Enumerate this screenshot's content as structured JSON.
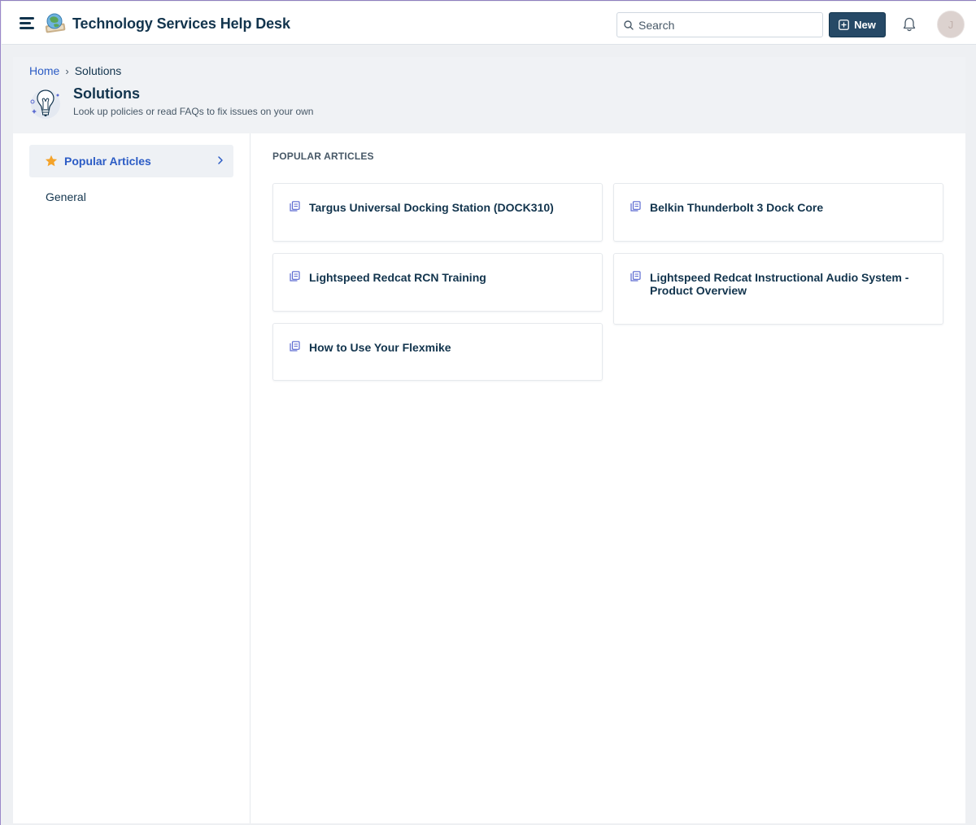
{
  "header": {
    "app_title": "Technology Services Help Desk",
    "search_placeholder": "Search",
    "new_button_label": "New",
    "avatar_initial": "J"
  },
  "breadcrumb": {
    "home": "Home",
    "current": "Solutions"
  },
  "page": {
    "title": "Solutions",
    "subtitle": "Look up policies or read FAQs to fix issues on your own"
  },
  "sidebar": {
    "items": [
      {
        "label": "Popular Articles",
        "active": true
      },
      {
        "label": "General",
        "active": false
      }
    ]
  },
  "main": {
    "section_title": "POPULAR ARTICLES",
    "articles": [
      {
        "title": "Targus Universal Docking Station (DOCK310)"
      },
      {
        "title": "Belkin Thunderbolt 3 Dock Core"
      },
      {
        "title": "Lightspeed Redcat RCN Training"
      },
      {
        "title": "Lightspeed Redcat Instructional Audio System - Product Overview"
      },
      {
        "title": "How to Use Your Flexmike"
      }
    ]
  },
  "colors": {
    "primary_text": "#12344d",
    "link": "#2c5cc5",
    "new_button_bg": "#264966",
    "star": "#f4a32a",
    "article_icon": "#5c6bd1"
  },
  "icons": {
    "menu": "hamburger-icon",
    "logo": "helpdesk-logo",
    "search": "search-icon",
    "new": "plus-square-icon",
    "notifications": "bell-icon",
    "page": "lightbulb-icon",
    "popular": "star-icon",
    "expand": "chevron-right-icon",
    "article": "document-icon"
  }
}
